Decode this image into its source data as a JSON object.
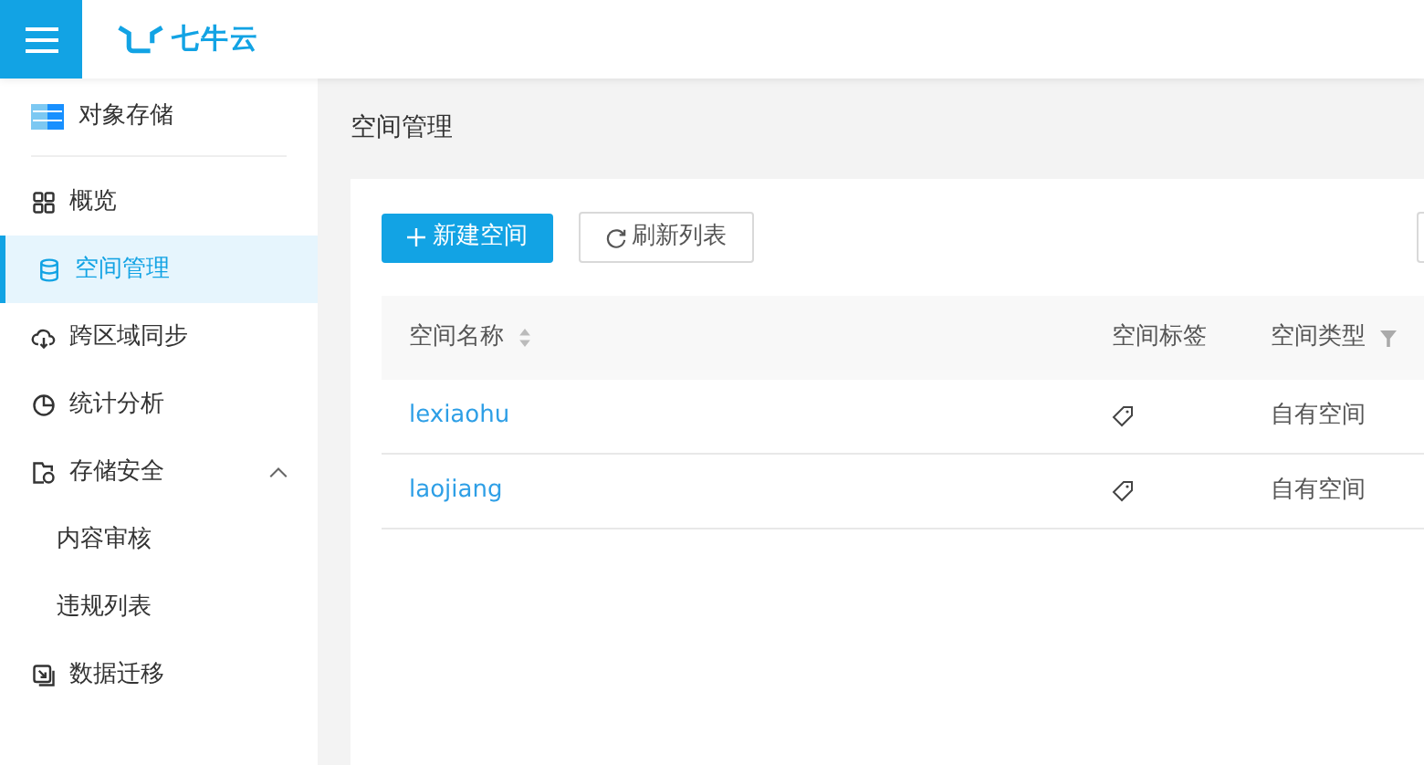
{
  "header": {
    "logo_text": "七牛云"
  },
  "sidebar": {
    "title": "对象存储",
    "items": [
      {
        "label": "概览",
        "selected": false
      },
      {
        "label": "空间管理",
        "selected": true
      },
      {
        "label": "跨区域同步",
        "selected": false
      },
      {
        "label": "统计分析",
        "selected": false
      },
      {
        "label": "存储安全",
        "selected": false,
        "expanded": true,
        "children": [
          {
            "label": "内容审核",
            "selected": false
          },
          {
            "label": "违规列表",
            "selected": false
          }
        ]
      },
      {
        "label": "数据迁移",
        "selected": false
      }
    ]
  },
  "page_title": "空间管理",
  "toolbar": {
    "buttons": [
      {
        "label": "新建空间",
        "kind": "primary"
      },
      {
        "label": "刷新列表",
        "kind": "refresh"
      }
    ]
  },
  "table": {
    "columns": [
      {
        "label": "空间名称",
        "sortable": true
      },
      {
        "label": "空间标签"
      },
      {
        "label": "空间类型",
        "filterable": true
      }
    ],
    "rows": [
      {
        "name": "lexiaohu",
        "type": "自有空间"
      },
      {
        "name": "laojiang",
        "type": "自有空间"
      }
    ]
  }
}
